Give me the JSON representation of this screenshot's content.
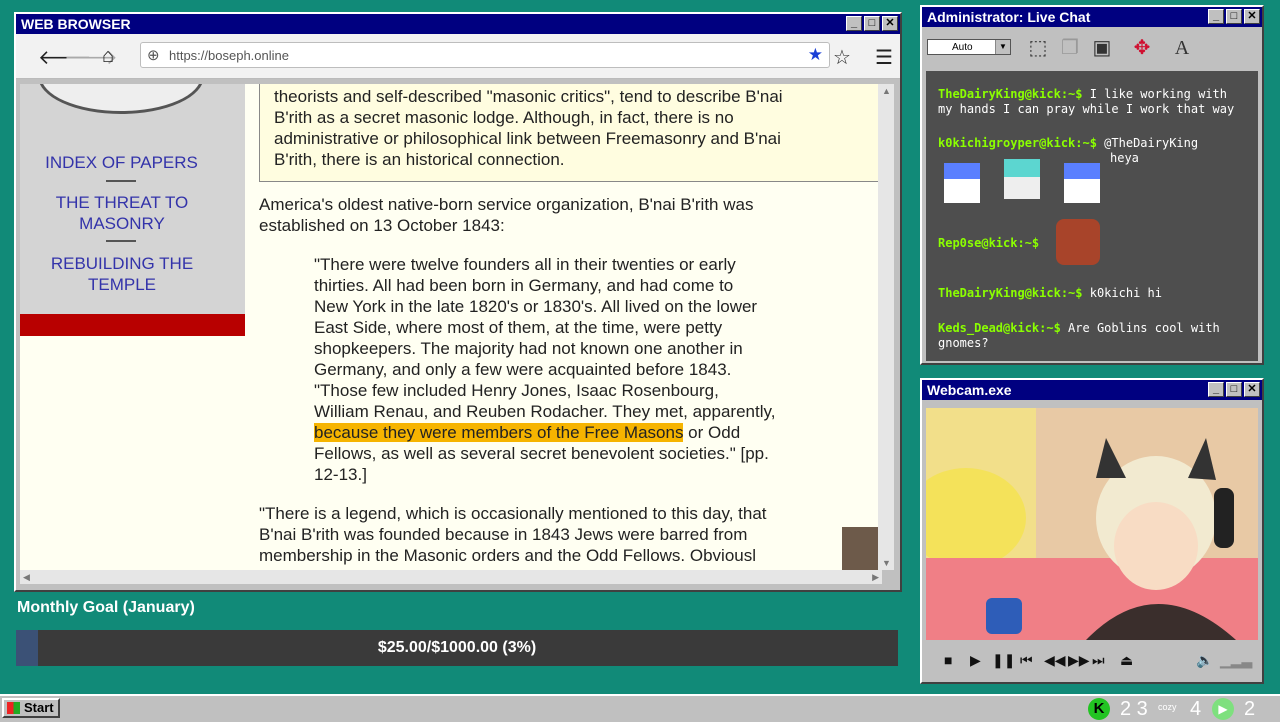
{
  "browser": {
    "title": "WEB BROWSER",
    "url": "https://boseph.online",
    "sidebar_links": [
      "INDEX OF PAPERS",
      "THE THREAT TO MASONRY",
      "REBUILDING THE TEMPLE"
    ],
    "box_lines": [
      "theorists and self-described \"masonic critics\", tend to describe B'nai",
      "B'rith as a secret masonic lodge. Although, in fact, there is no",
      "administrative or philosophical link between Freemasonry and B'nai",
      "B'rith, there is an historical connection."
    ],
    "para1_lines": [
      "America's oldest native-born service organization, B'nai B'rith was",
      "established on 13 October 1843:"
    ],
    "quote_lines": [
      "\"There were twelve founders all in their twenties or early",
      "thirties. All had been born in Germany, and had come to",
      "New York in the late 1820's or 1830's. All lived on the lower",
      "East Side, where most of them, at the time, were petty",
      "shopkeepers. The majority had not known one another in",
      "Germany, and only a few were acquainted before 1843.",
      "\"Those few included Henry Jones, Isaac Rosenbourg,",
      "William Renau, and Reuben Rodacher. They met, apparently,"
    ],
    "quote_highlight": "because they were members of the Free Masons",
    "quote_after_highlight": " or Odd",
    "quote_tail_lines": [
      "Fellows, as well as several secret benevolent societies.\" [pp.",
      "12-13.]"
    ],
    "para2_lines": [
      "\"There is a legend, which is occasionally mentioned to this day, that",
      "B'nai B'rith was founded because in 1843 Jews were barred from",
      "membership in the Masonic orders and the Odd Fellows. Obviousl"
    ]
  },
  "chat": {
    "title": "Administrator: Live Chat",
    "select_value": "Auto",
    "messages": [
      {
        "user": "TheDairyKing@kick:~$",
        "text": " I like working with",
        "text2": "my hands I can pray while I work that way"
      },
      {
        "user": "k0kichigroyper@kick:~$",
        "text": " @TheDairyKing",
        "text2": "heya"
      },
      {
        "user": "Rep0se@kick:~$",
        "text": "",
        "text2": ""
      },
      {
        "user": "TheDairyKing@kick:~$",
        "text": " k0kichi hi",
        "text2": ""
      },
      {
        "user": "Keds_Dead@kick:~$",
        "text": " Are Goblins cool with",
        "text2": "gnomes?"
      }
    ]
  },
  "webcam": {
    "title": "Webcam.exe"
  },
  "goal": {
    "title": "Monthly Goal (January)",
    "text": "$25.00/$1000.00 (3%)",
    "progress": 0.025
  },
  "taskbar": {
    "start_label": "Start",
    "tray1": "2 3",
    "tray_small": "cozy",
    "tray2": "4",
    "tray3": "2"
  },
  "colors": {
    "desktop": "#118a78",
    "titlebar": "#000080",
    "highlight": "#f6b400",
    "chat_user": "#8bff00"
  }
}
